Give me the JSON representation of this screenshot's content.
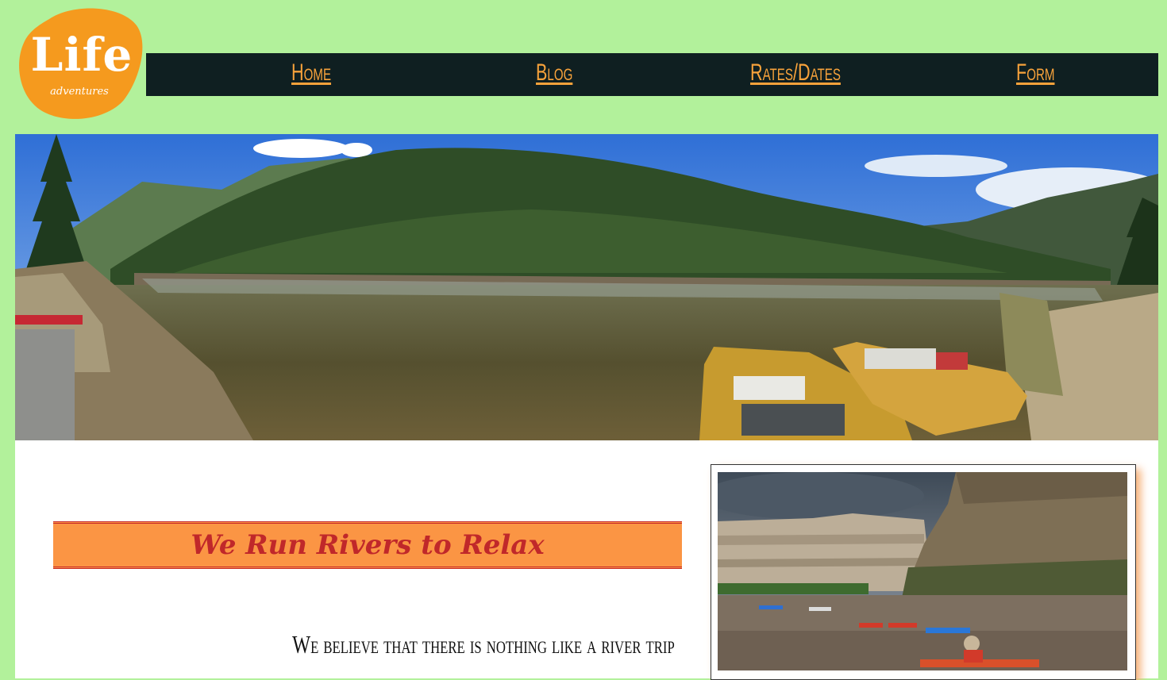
{
  "logo": {
    "main": "Life",
    "sub": "adventures"
  },
  "nav": {
    "items": [
      "Home",
      "Blog",
      "Rates/Dates",
      "Form"
    ]
  },
  "hero": {
    "alt": "hero-river-panorama"
  },
  "content": {
    "heading": "We Run Rivers to Relax",
    "tagline": "We believe that there is nothing like a river trip"
  },
  "colors": {
    "background": "#b2f19b",
    "nav_bg": "#0f1f21",
    "nav_link": "#f7a23b",
    "logo_orange": "#f59a1e",
    "banner_bg": "#fb9544",
    "banner_text": "#c0282a"
  }
}
